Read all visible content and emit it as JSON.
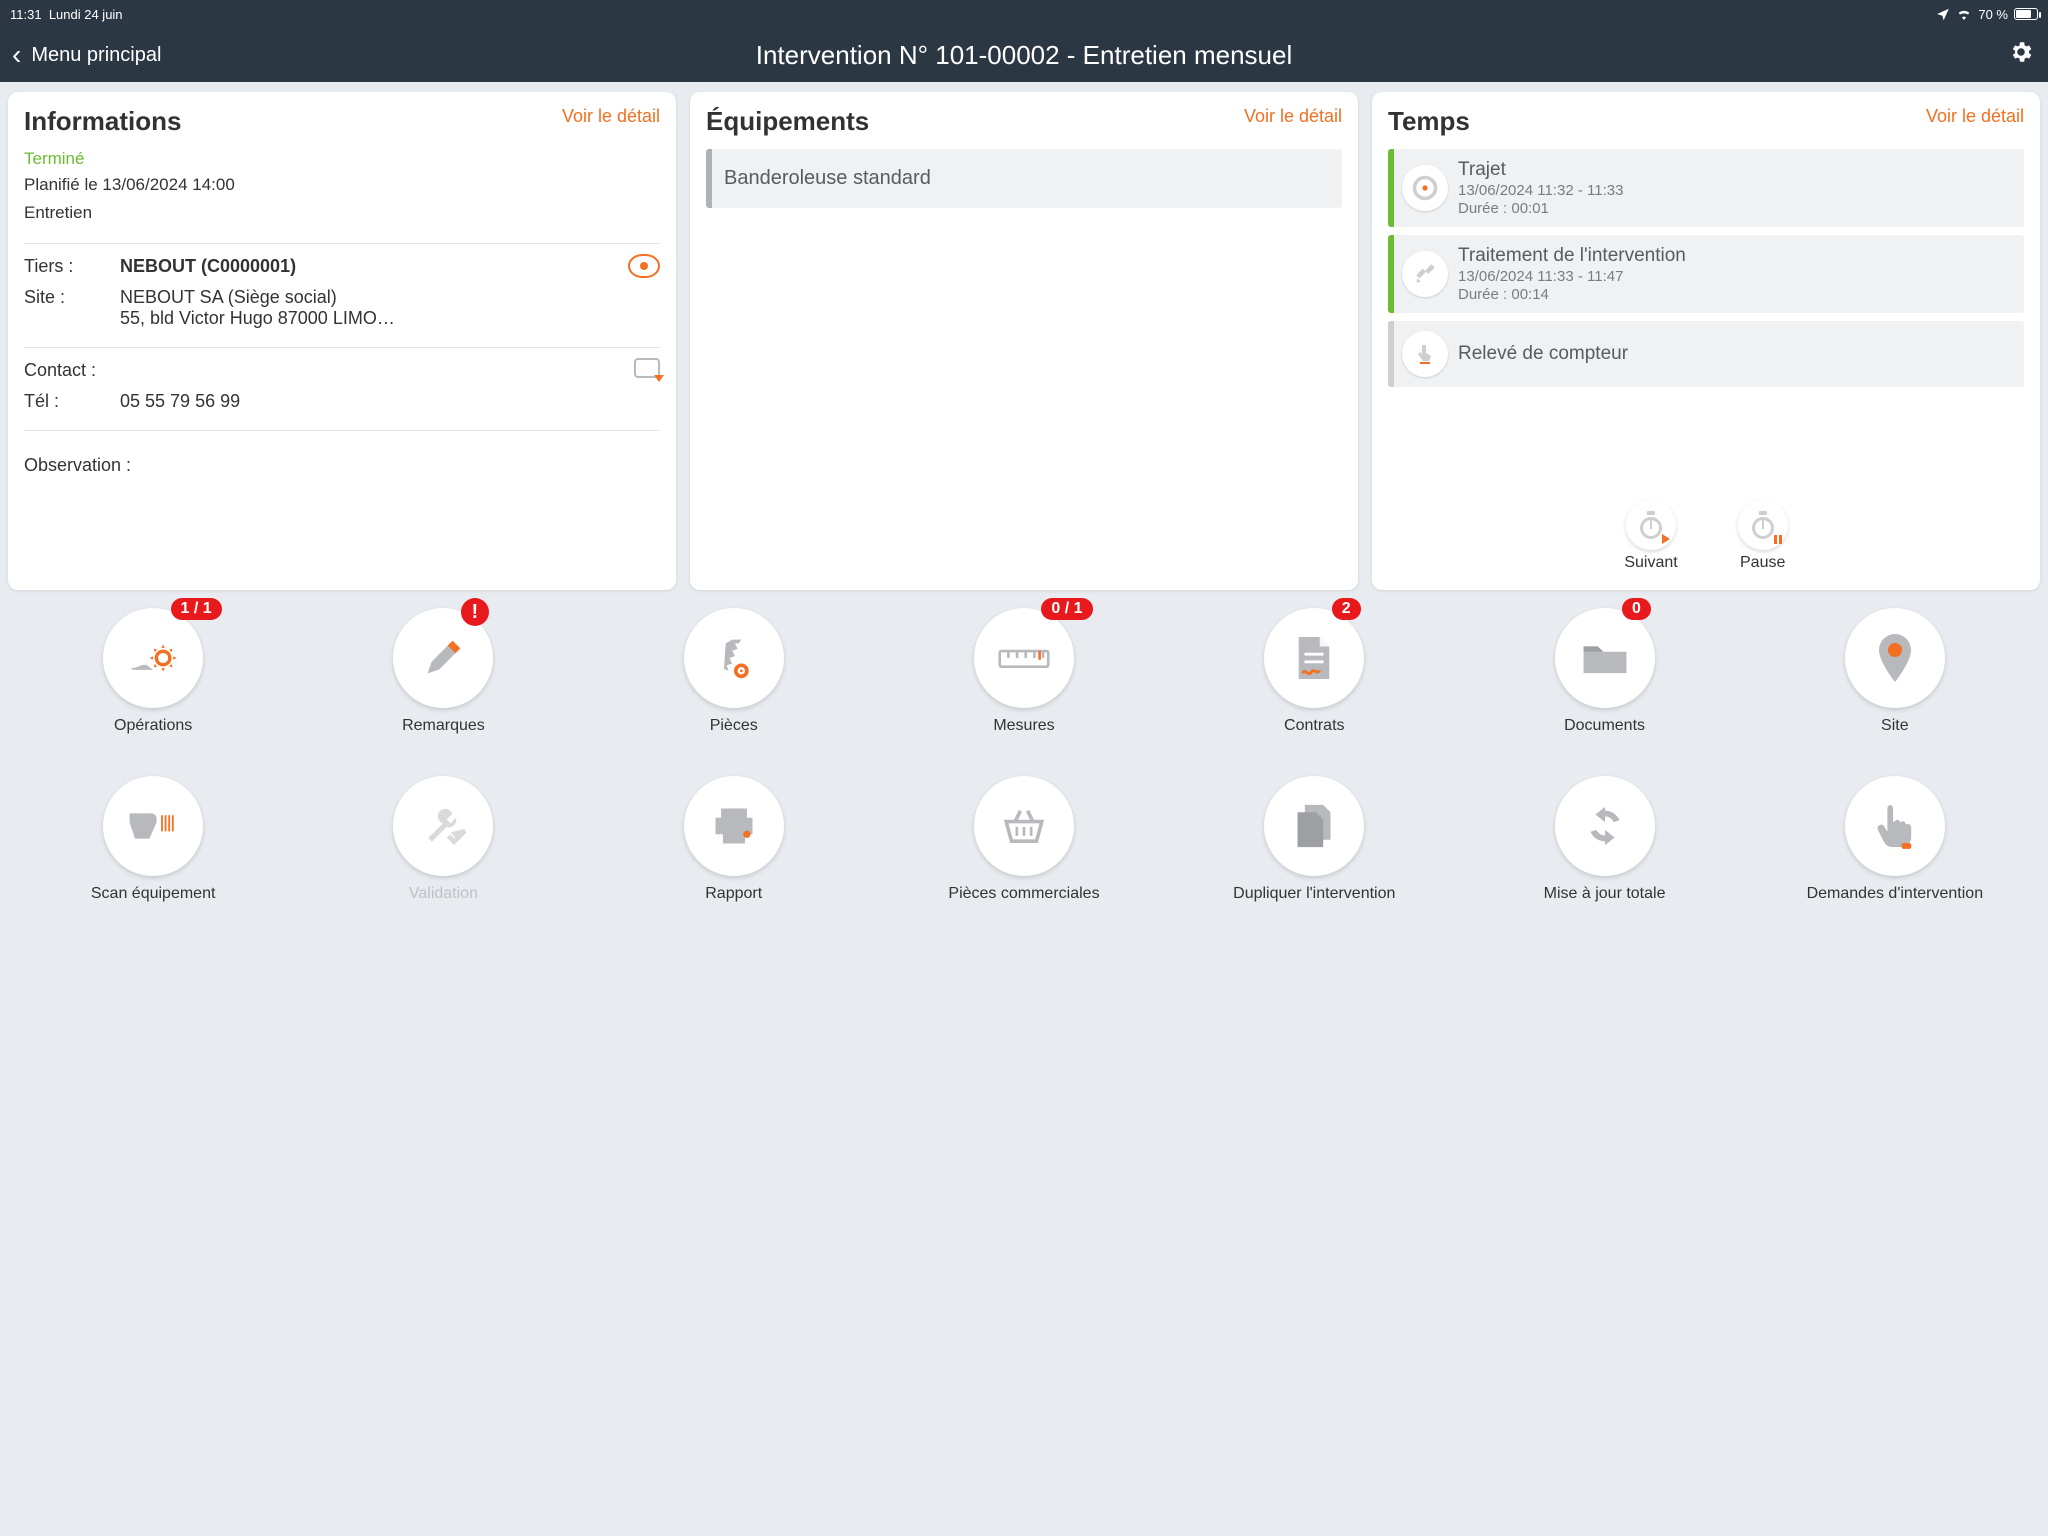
{
  "statusbar": {
    "time": "11:31",
    "date": "Lundi 24 juin",
    "battery": "70 %"
  },
  "nav": {
    "back": "Menu principal",
    "title": "Intervention N° 101-00002 - Entretien mensuel"
  },
  "info": {
    "header": "Informations",
    "more": "Voir le détail",
    "status": "Terminé",
    "planned": "Planifié le 13/06/2024 14:00",
    "type": "Entretien",
    "tiers_label": "Tiers :",
    "tiers_value": "NEBOUT (C0000001)",
    "site_label": "Site :",
    "site_value1": "NEBOUT SA (Siège social)",
    "site_value2": "55, bld Victor Hugo 87000 LIMO…",
    "contact_label": "Contact :",
    "tel_label": "Tél :",
    "tel_value": "05 55 79 56 99",
    "obs_label": "Observation :"
  },
  "equip": {
    "header": "Équipements",
    "more": "Voir le détail",
    "items": [
      "Banderoleuse standard"
    ]
  },
  "temps": {
    "header": "Temps",
    "more": "Voir le détail",
    "items": [
      {
        "title": "Trajet",
        "sub1": "13/06/2024 11:32 - 11:33",
        "sub2": "Durée : 00:01",
        "done": true
      },
      {
        "title": "Traitement de l'intervention",
        "sub1": "13/06/2024 11:33 - 11:47",
        "sub2": "Durée : 00:14",
        "done": true
      },
      {
        "title": "Relevé de compteur",
        "sub1": "",
        "sub2": "",
        "done": false
      }
    ],
    "suivant": "Suivant",
    "pause": "Pause"
  },
  "grid": {
    "operations": {
      "label": "Opérations",
      "badge": "1 / 1"
    },
    "remarques": {
      "label": "Remarques",
      "badge": "!"
    },
    "pieces": {
      "label": "Pièces"
    },
    "mesures": {
      "label": "Mesures",
      "badge": "0 / 1"
    },
    "contrats": {
      "label": "Contrats",
      "badge": "2"
    },
    "documents": {
      "label": "Documents",
      "badge": "0"
    },
    "site": {
      "label": "Site"
    },
    "scan": {
      "label": "Scan équipement"
    },
    "validation": {
      "label": "Validation",
      "disabled": true
    },
    "rapport": {
      "label": "Rapport"
    },
    "commerciales": {
      "label": "Pièces commerciales"
    },
    "dupliquer": {
      "label": "Dupliquer l'intervention"
    },
    "maj": {
      "label": "Mise à jour totale"
    },
    "demandes": {
      "label": "Demandes d'intervention"
    }
  }
}
